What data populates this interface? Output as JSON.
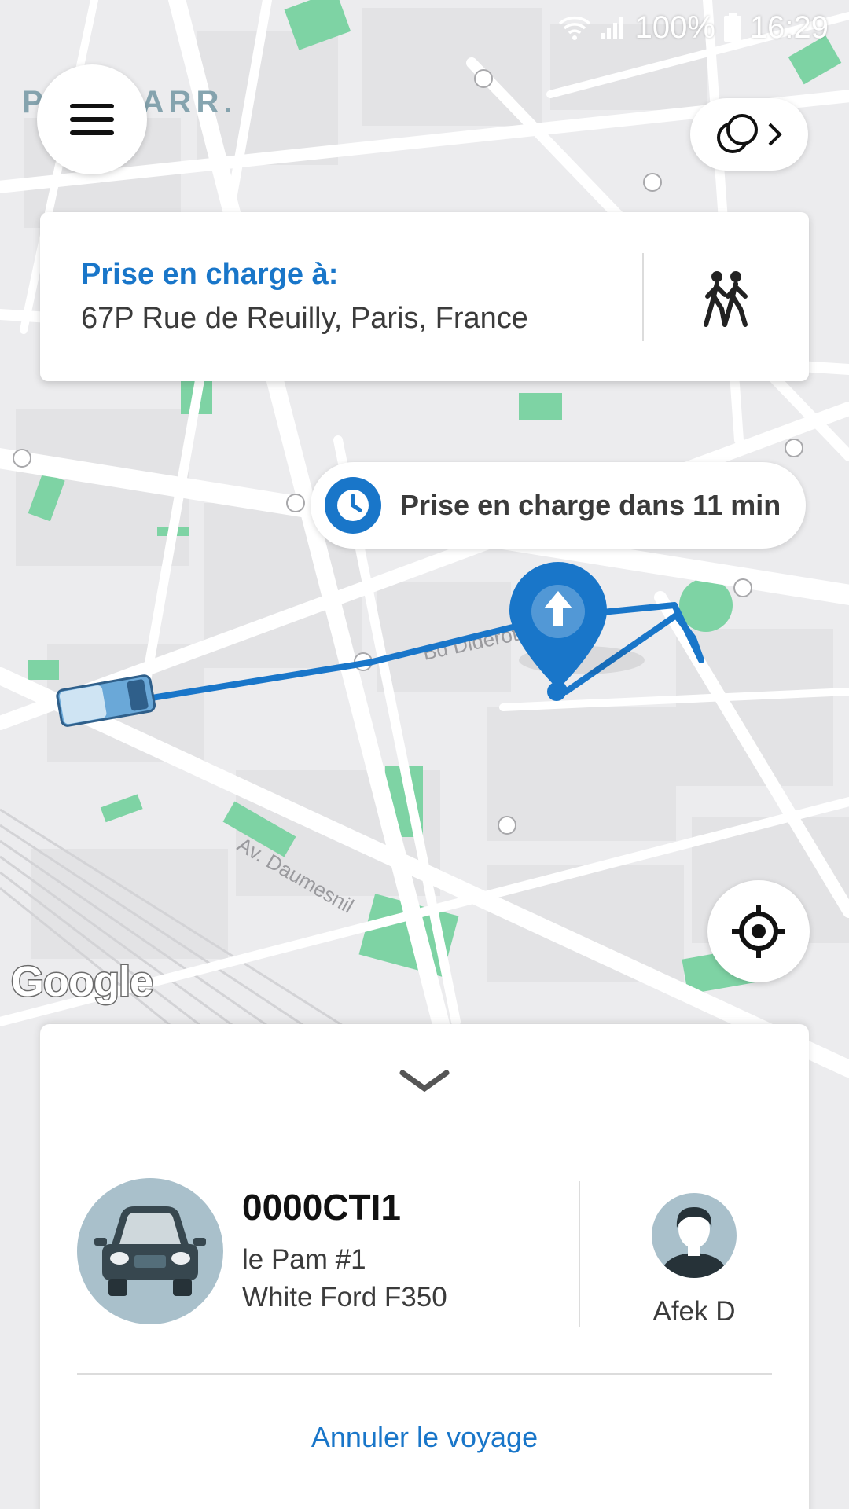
{
  "status_bar": {
    "battery": "100%",
    "time": "16:29"
  },
  "map": {
    "district_label": "P  11E ARR.",
    "street_labels": [
      "Bd Diderot",
      "Av. Daumesnil"
    ],
    "colors": {
      "route": "#1976c9",
      "park": "#7ed3a4",
      "road": "#ffffff",
      "block": "#e2e2e4"
    }
  },
  "header": {
    "menu_icon": "hamburger-icon",
    "services_icon": "overlap-circles-icon"
  },
  "pickup": {
    "title": "Prise en charge à:",
    "address": "67P Rue de Reuilly, Paris, France",
    "walk_icon": "walking-people-icon"
  },
  "eta": {
    "text": "Prise en charge dans 11 min",
    "icon": "clock-icon"
  },
  "map_branding": {
    "google_logo": "Google"
  },
  "vehicle": {
    "plate": "0000CTI1",
    "name": "le Pam #1",
    "model": "White Ford F350"
  },
  "driver": {
    "name": "Afek D"
  },
  "actions": {
    "cancel_label": "Annuler le voyage"
  },
  "colors": {
    "accent": "#1976c9",
    "avatar_bg": "#a9c0cb"
  }
}
